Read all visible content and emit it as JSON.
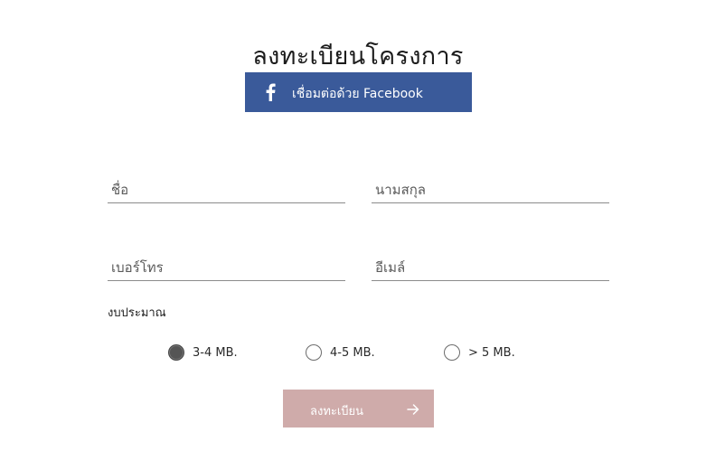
{
  "page": {
    "title": "ลงทะเบียนโครงการ"
  },
  "facebook": {
    "label": "เชื่อมต่อด้วย Facebook",
    "icon": "facebook-icon",
    "color": "#3a5a9a"
  },
  "form": {
    "firstname": {
      "placeholder": "ชื่อ",
      "value": ""
    },
    "lastname": {
      "placeholder": "นามสกุล",
      "value": ""
    },
    "phone": {
      "placeholder": "เบอร์โทร",
      "value": ""
    },
    "email": {
      "placeholder": "อีเมล์",
      "value": ""
    },
    "budget": {
      "label": "งบประมาณ",
      "options": [
        {
          "label": "3-4 MB.",
          "selected": true
        },
        {
          "label": "4-5 MB.",
          "selected": false
        },
        {
          "label": "> 5 MB.",
          "selected": false
        }
      ]
    }
  },
  "submit": {
    "label": "ลงทะเบียน",
    "icon": "arrow-right-icon",
    "color": "#cfabaa"
  }
}
